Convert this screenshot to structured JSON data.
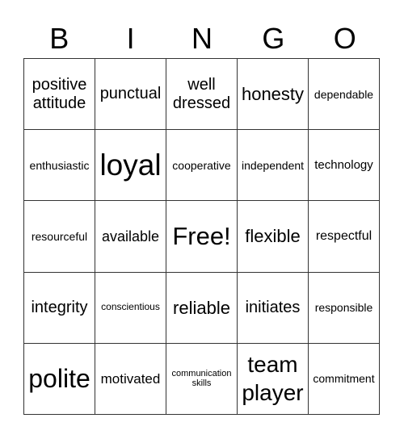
{
  "header": {
    "letters": [
      "B",
      "I",
      "N",
      "G",
      "O"
    ]
  },
  "board": {
    "rows": [
      [
        "positive\nattitude",
        "punctual",
        "well\ndressed",
        "honesty",
        "dependable"
      ],
      [
        "enthusiastic",
        "loyal",
        "cooperative",
        "independent",
        "technology"
      ],
      [
        "resourceful",
        "available",
        "Free!",
        "flexible",
        "respectful"
      ],
      [
        "integrity",
        "conscientious",
        "reliable",
        "initiates",
        "responsible"
      ],
      [
        "polite",
        "motivated",
        "communication\nskills",
        "team\nplayer",
        "commitment"
      ]
    ],
    "free_space": "Free!"
  }
}
